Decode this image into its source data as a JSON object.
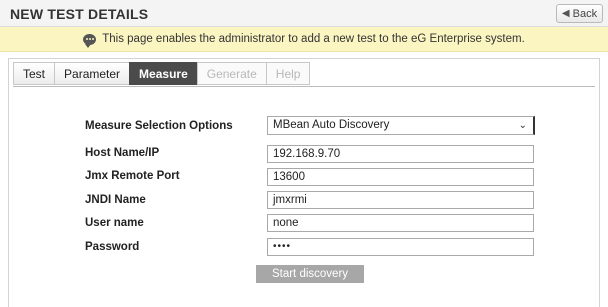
{
  "header": {
    "title": "NEW TEST DETAILS",
    "back_label": "Back"
  },
  "notice": {
    "icon": "speech-bubble-icon",
    "text": "This page enables the administrator to add a new test to the eG Enterprise system."
  },
  "tabs": [
    {
      "label": "Test",
      "state": "normal"
    },
    {
      "label": "Parameter",
      "state": "normal"
    },
    {
      "label": "Measure",
      "state": "active"
    },
    {
      "label": "Generate",
      "state": "disabled"
    },
    {
      "label": "Help",
      "state": "disabled"
    }
  ],
  "form": {
    "measure_selection": {
      "label": "Measure Selection Options",
      "value": "MBean Auto Discovery"
    },
    "host": {
      "label": "Host Name/IP",
      "value": "192.168.9.70"
    },
    "jmx_port": {
      "label": "Jmx Remote Port",
      "value": "13600"
    },
    "jndi": {
      "label": "JNDI Name",
      "value": "jmxrmi"
    },
    "username": {
      "label": "User name",
      "value": "none"
    },
    "password": {
      "label": "Password",
      "value": "••••"
    },
    "start_button": "Start discovery"
  },
  "colors": {
    "notice_bg": "#fbf5c2",
    "active_tab": "#4b4b4b",
    "start_button": "#a7a7a7"
  }
}
